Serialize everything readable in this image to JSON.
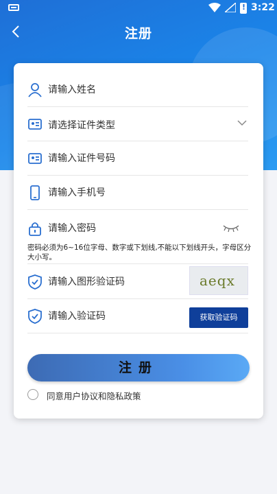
{
  "status_bar": {
    "time": "3:22"
  },
  "nav": {
    "title": "注册"
  },
  "form": {
    "name": {
      "placeholder": "请输入姓名",
      "icon": "user-icon"
    },
    "id_type": {
      "placeholder": "请选择证件类型",
      "icon": "id-card-icon"
    },
    "id_number": {
      "placeholder": "请输入证件号码",
      "icon": "id-card-icon"
    },
    "phone": {
      "placeholder": "请输入手机号",
      "icon": "phone-icon"
    },
    "password": {
      "placeholder": "请输入密码",
      "icon": "lock-icon",
      "hint": "密码必须为6~16位字母、数字或下划线,不能以下划线开头，字母区分大小写。"
    },
    "captcha": {
      "placeholder": "请输入图形验证码",
      "icon": "shield-check-icon",
      "image_text": "aeqx"
    },
    "sms_code": {
      "placeholder": "请输入验证码",
      "icon": "shield-check-icon",
      "button_label": "获取验证码"
    }
  },
  "submit": {
    "label": "注册"
  },
  "agreement": {
    "label": "同意用户协议和隐私政策",
    "checked": false
  },
  "colors": {
    "primary": "#1a86ea",
    "button_dark": "#0f3f9a"
  }
}
